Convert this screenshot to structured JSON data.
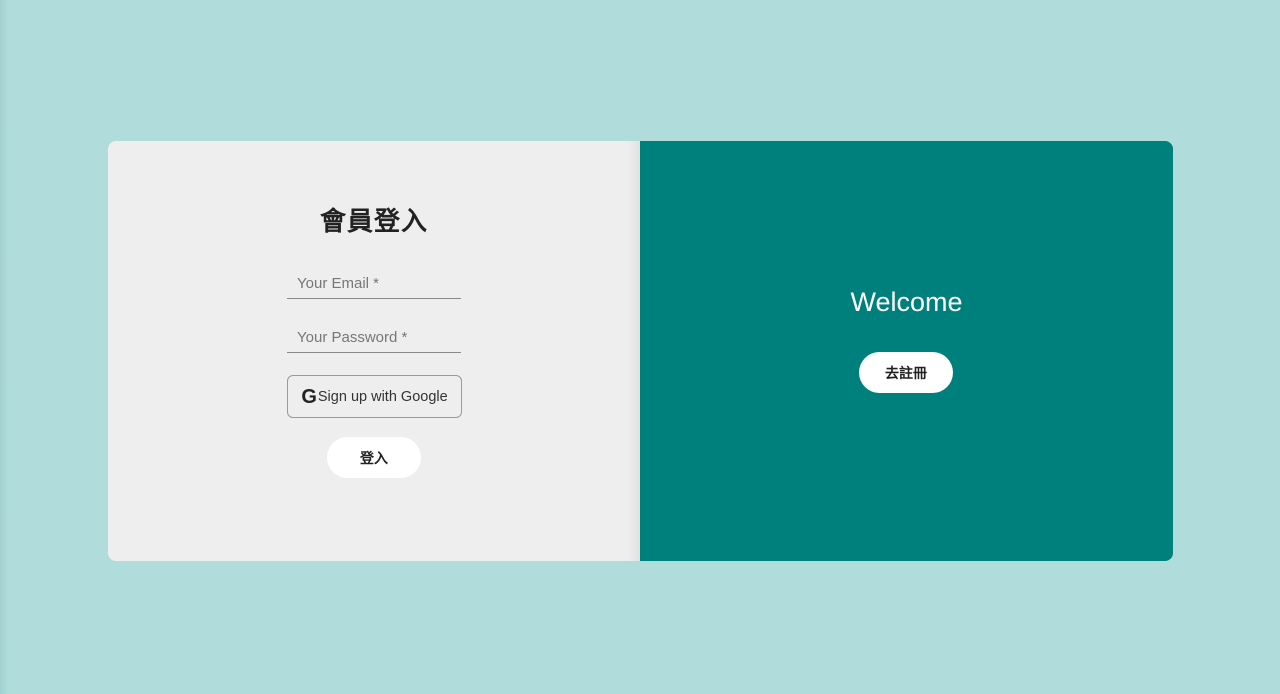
{
  "login": {
    "title": "會員登入",
    "email_placeholder": "Your Email *",
    "password_placeholder": "Your Password *",
    "google_icon_text": "G",
    "google_label": "Sign up with Google",
    "submit_label": "登入"
  },
  "welcome": {
    "title": "Welcome",
    "register_label": "去註冊"
  },
  "colors": {
    "background": "#b0dcdc",
    "left_panel": "#eeeeee",
    "right_panel": "#00807c",
    "button": "#ffffff"
  },
  "icons": {
    "google": "google-icon"
  }
}
